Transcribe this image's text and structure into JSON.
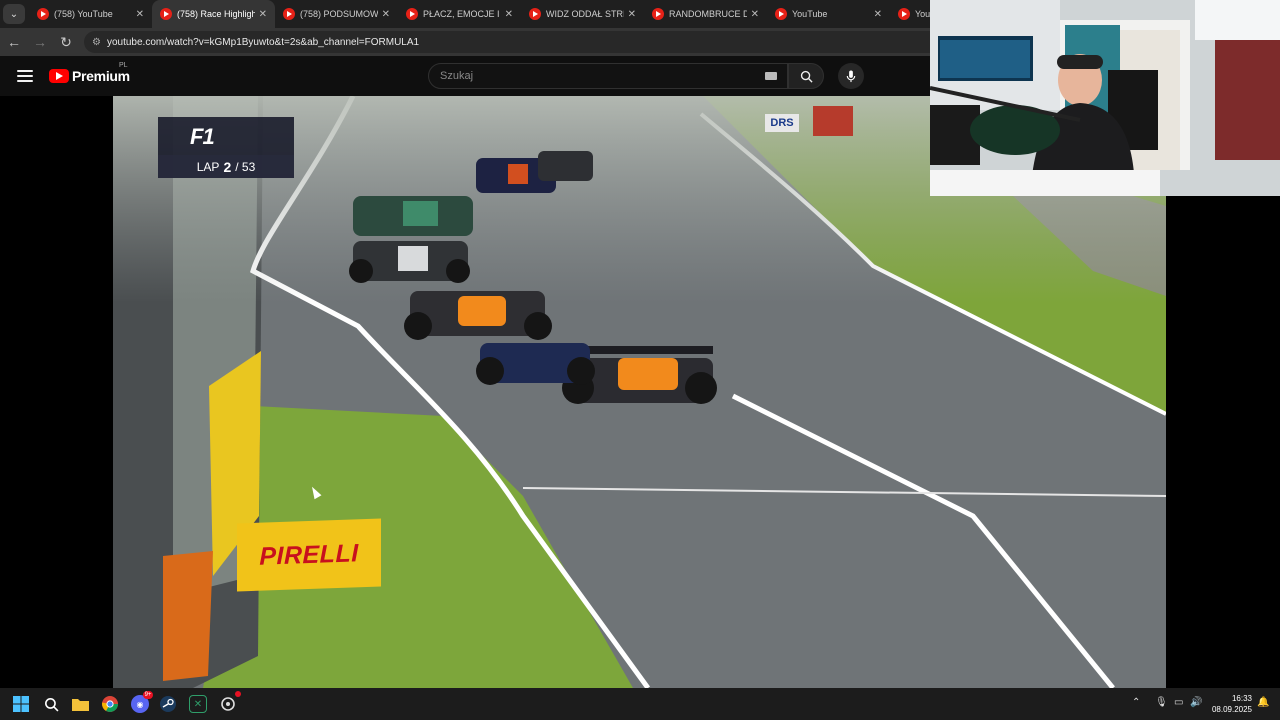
{
  "browser": {
    "tabs": [
      {
        "title": "(758) YouTube",
        "active": false
      },
      {
        "title": "(758) Race Highlights",
        "active": true
      },
      {
        "title": "(758) PODSUMOWAN",
        "active": false
      },
      {
        "title": "PŁACZ, EMOCJE I KON",
        "active": false
      },
      {
        "title": "WIDZ ODDAŁ STRIMI",
        "active": false
      },
      {
        "title": "RANDOMBRUCE DUŻ",
        "active": false
      },
      {
        "title": "YouTube",
        "active": false
      },
      {
        "title": "YouTu",
        "active": false
      }
    ],
    "tab_close_glyph": "✕",
    "tab_list_glyph": "⌄",
    "url": "youtube.com/watch?v=kGMp1Byuwto&t=2s&ab_channel=FORMULA1"
  },
  "youtube": {
    "brand": "Premium",
    "country": "PL",
    "search_placeholder": "Szukaj"
  },
  "video": {
    "f1_logo": "F1",
    "lap_label": "LAP",
    "lap_current": "2",
    "lap_total": "/ 53",
    "pirelli": "PIRELLI",
    "drs": "DRS"
  },
  "taskbar": {
    "time": "16:33",
    "date": "08.09.2025",
    "discord_badge": "9+"
  },
  "colors": {
    "chrome_dark": "#1f1f1f",
    "youtube_red": "#ff0000",
    "grass": "#7ea53a",
    "asphalt": "#6d7275"
  }
}
